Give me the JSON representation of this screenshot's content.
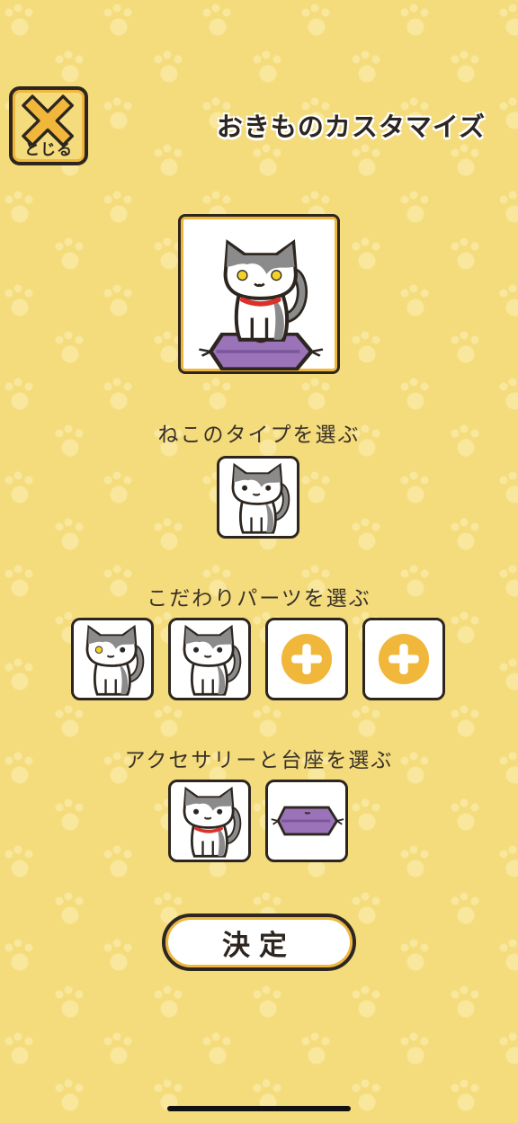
{
  "header": {
    "close_label": "とじる",
    "title": "おきものカスタマイズ"
  },
  "sections": [
    {
      "label": "ねこのタイプを選ぶ"
    },
    {
      "label": "こだわりパーツを選ぶ"
    },
    {
      "label": "アクセサリーと台座を選ぶ"
    }
  ],
  "confirm": {
    "label": "決定"
  },
  "colors": {
    "background": "#f4dc7c",
    "accent": "#f0b73a",
    "outline": "#2d2620",
    "cushion": "#9b73b8",
    "collar": "#d9322a"
  },
  "icons": {
    "close": "x-icon",
    "add": "plus-icon",
    "cat": "cat-icon",
    "cushion": "cushion-icon"
  }
}
